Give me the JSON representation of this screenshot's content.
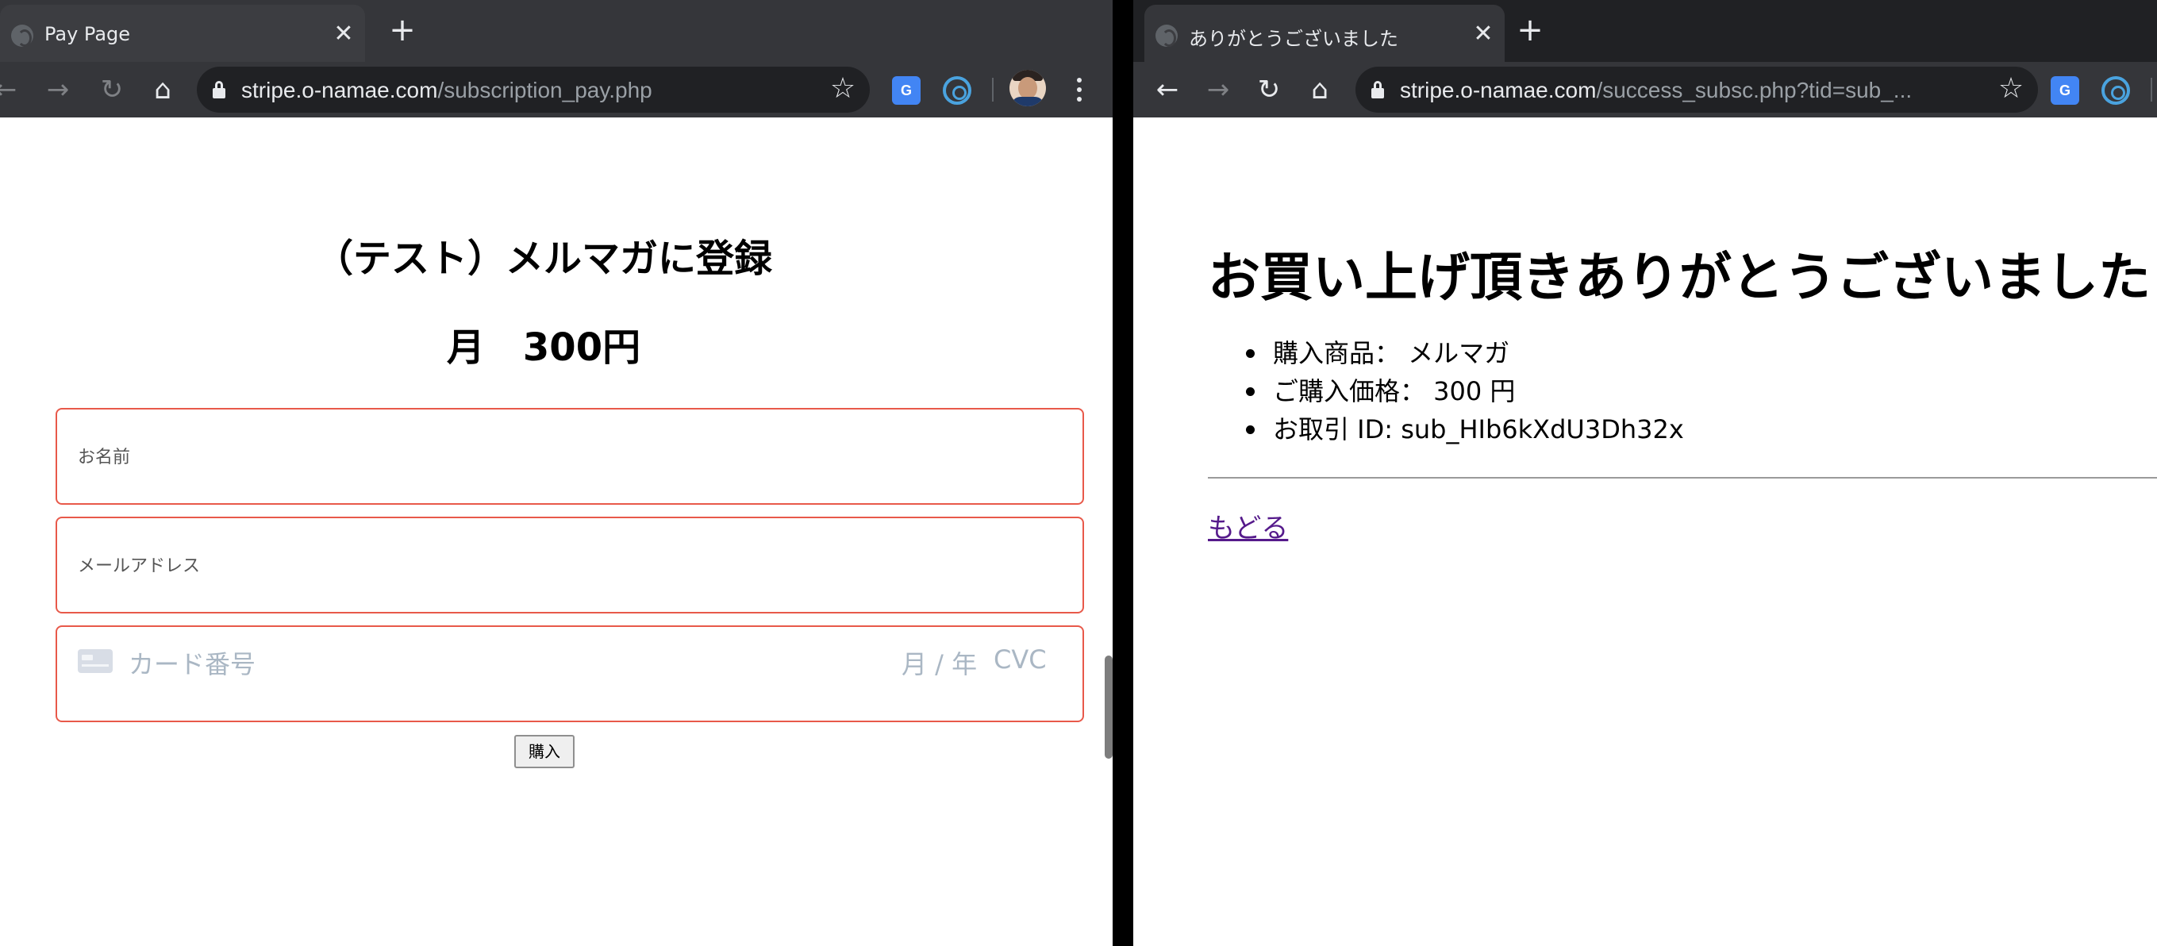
{
  "left_window": {
    "tab": {
      "title": "Pay Page",
      "close": "✕"
    },
    "new_tab": "+",
    "nav": {
      "back": "←",
      "forward": "→",
      "reload": "↻",
      "home": "⌂"
    },
    "url": {
      "host": "stripe.o-namae.com",
      "path": "/subscription_pay.php"
    },
    "star": "☆",
    "extensions": {
      "translate": "G",
      "swirl": ""
    },
    "page": {
      "title": "（テスト）メルマガに登録",
      "price": "月　300円",
      "name_placeholder": "お名前",
      "email_placeholder": "メールアドレス",
      "card_number_placeholder": "カード番号",
      "card_expiry_placeholder": "月 / 年",
      "card_cvc_placeholder": "CVC",
      "buy_label": "購入"
    }
  },
  "right_window": {
    "tab": {
      "title": "ありがとうございました",
      "close": "✕"
    },
    "new_tab": "+",
    "nav": {
      "back": "←",
      "forward": "→",
      "reload": "↻",
      "home": "⌂"
    },
    "url": {
      "host": "stripe.o-namae.com",
      "path": "/success_subsc.php?tid=sub_..."
    },
    "star": "☆",
    "extensions": {
      "translate": "G"
    },
    "page": {
      "title": "お買い上げ頂きありがとうございました",
      "details": [
        "購入商品： メルマガ",
        "ご購入価格： 300 円",
        "お取引 ID: sub_HIb6kXdU3Dh32x"
      ],
      "back_link": "もどる"
    }
  },
  "colors": {
    "chrome_dark": "#202124",
    "chrome_toolbar": "#35363a",
    "field_border": "#e8594a",
    "link_visited": "#551a8b"
  }
}
